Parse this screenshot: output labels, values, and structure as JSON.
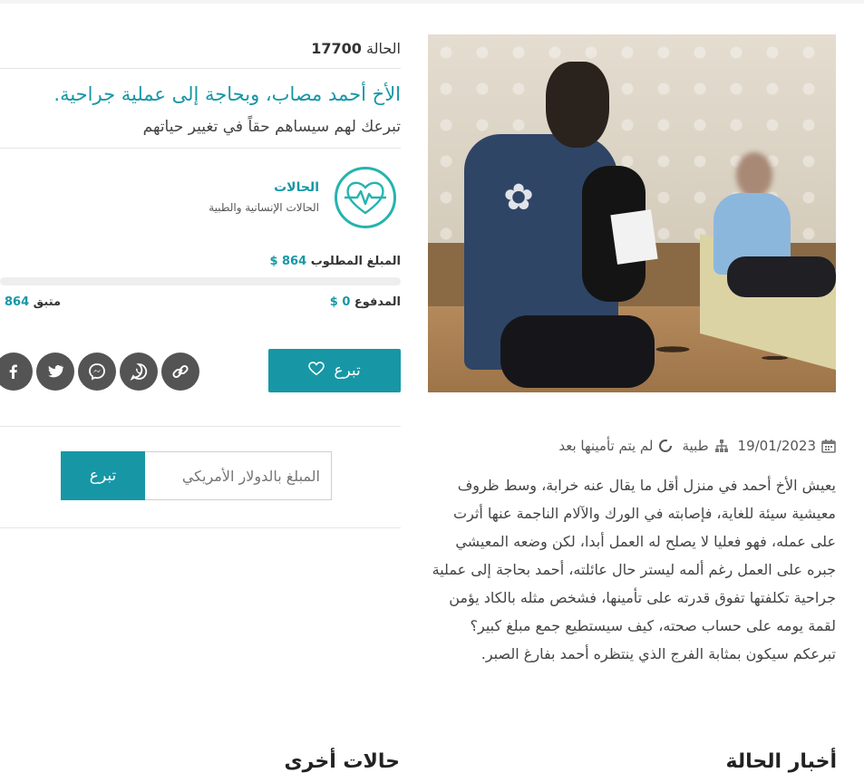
{
  "case": {
    "number_label": "الحالة",
    "number": "17700",
    "title": "الأخ أحمد مصاب، وبحاجة إلى عملية جراحية.",
    "subtitle": "تبرعك لهم سيساهم حقاً في تغيير حياتهم"
  },
  "category": {
    "title": "الحالات",
    "subtitle": "الحالات الإنسانية والطبية",
    "icon": "heartbeat-icon",
    "color": "#26b3b0"
  },
  "funding": {
    "required_label": "المبلغ المطلوب",
    "required_value": "864 $",
    "paid_label": "المدفوع",
    "paid_value": "0 $",
    "remaining_label": "متبق",
    "remaining_value": "864",
    "progress_fraction": 0
  },
  "actions": {
    "donate_label": "تبرع",
    "amount_placeholder": "المبلغ بالدولار الأمريكي",
    "amount_button": "تبرع",
    "share_icons": [
      "link-icon",
      "whatsapp-icon",
      "messenger-icon",
      "twitter-icon",
      "facebook-icon"
    ]
  },
  "details": {
    "date": "19/01/2023",
    "type": "طبية",
    "status": "لم يتم تأمينها بعد",
    "description": "يعيش الأخ أحمد في منزل أقل ما يقال عنه خرابة، وسط ظروف معيشية سيئة للغاية، فإصابته في الورك والآلام الناجمة عنها أثرت على عمله، فهو فعليا لا يصلح له العمل أبدا، لكن وضعه المعيشي جبره على العمل رغم ألمه ليستر حال عائلته، أحمد بحاجة إلى عملية جراحية تكلفتها تفوق قدرته على تأمينها، فشخص مثله بالكاد يؤمن لقمة يومه على حساب صحته، كيف سيستطيع جمع مبلغ كبير؟ تبرعكم سيكون بمثابة الفرج الذي ينتظره أحمد بفارغ الصبر."
  },
  "bottom": {
    "left_heading": "حالات أخرى",
    "right_heading": "أخبار الحالة"
  },
  "colors": {
    "accent": "#1797a5",
    "share_bg": "#545454"
  }
}
